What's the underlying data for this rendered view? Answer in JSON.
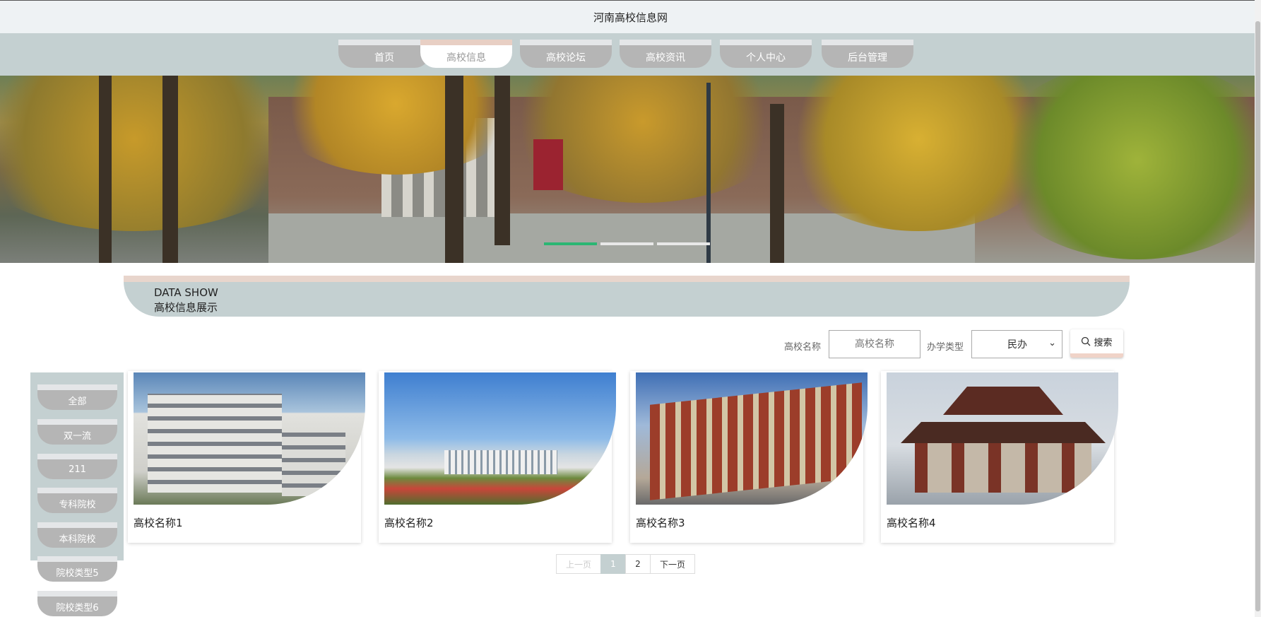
{
  "site": {
    "title": "河南高校信息网"
  },
  "nav": {
    "items": [
      {
        "label": "首页",
        "active": false
      },
      {
        "label": "高校信息",
        "active": true
      },
      {
        "label": "高校论坛",
        "active": false
      },
      {
        "label": "高校资讯",
        "active": false
      },
      {
        "label": "个人中心",
        "active": false
      },
      {
        "label": "后台管理",
        "active": false
      }
    ]
  },
  "banner": {
    "slides": 3,
    "active_slide": 1
  },
  "section": {
    "en": "DATA SHOW",
    "cn": "高校信息展示"
  },
  "search": {
    "name_label": "高校名称",
    "name_placeholder": "高校名称",
    "type_label": "办学类型",
    "type_value": "民办",
    "button_label": "搜索"
  },
  "categories": [
    "全部",
    "双一流",
    "211",
    "专科院校",
    "本科院校",
    "院校类型5",
    "院校类型6"
  ],
  "cards": [
    {
      "name": "高校名称1"
    },
    {
      "name": "高校名称2"
    },
    {
      "name": "高校名称3"
    },
    {
      "name": "高校名称4"
    }
  ],
  "pagination": {
    "prev": "上一页",
    "pages": [
      "1",
      "2"
    ],
    "current": "1",
    "next": "下一页"
  },
  "colors": {
    "accent": "#c4d0d1",
    "tab": "#b5b5b5",
    "active_dot": "#2bb673",
    "highlight": "#e8d5cc"
  }
}
